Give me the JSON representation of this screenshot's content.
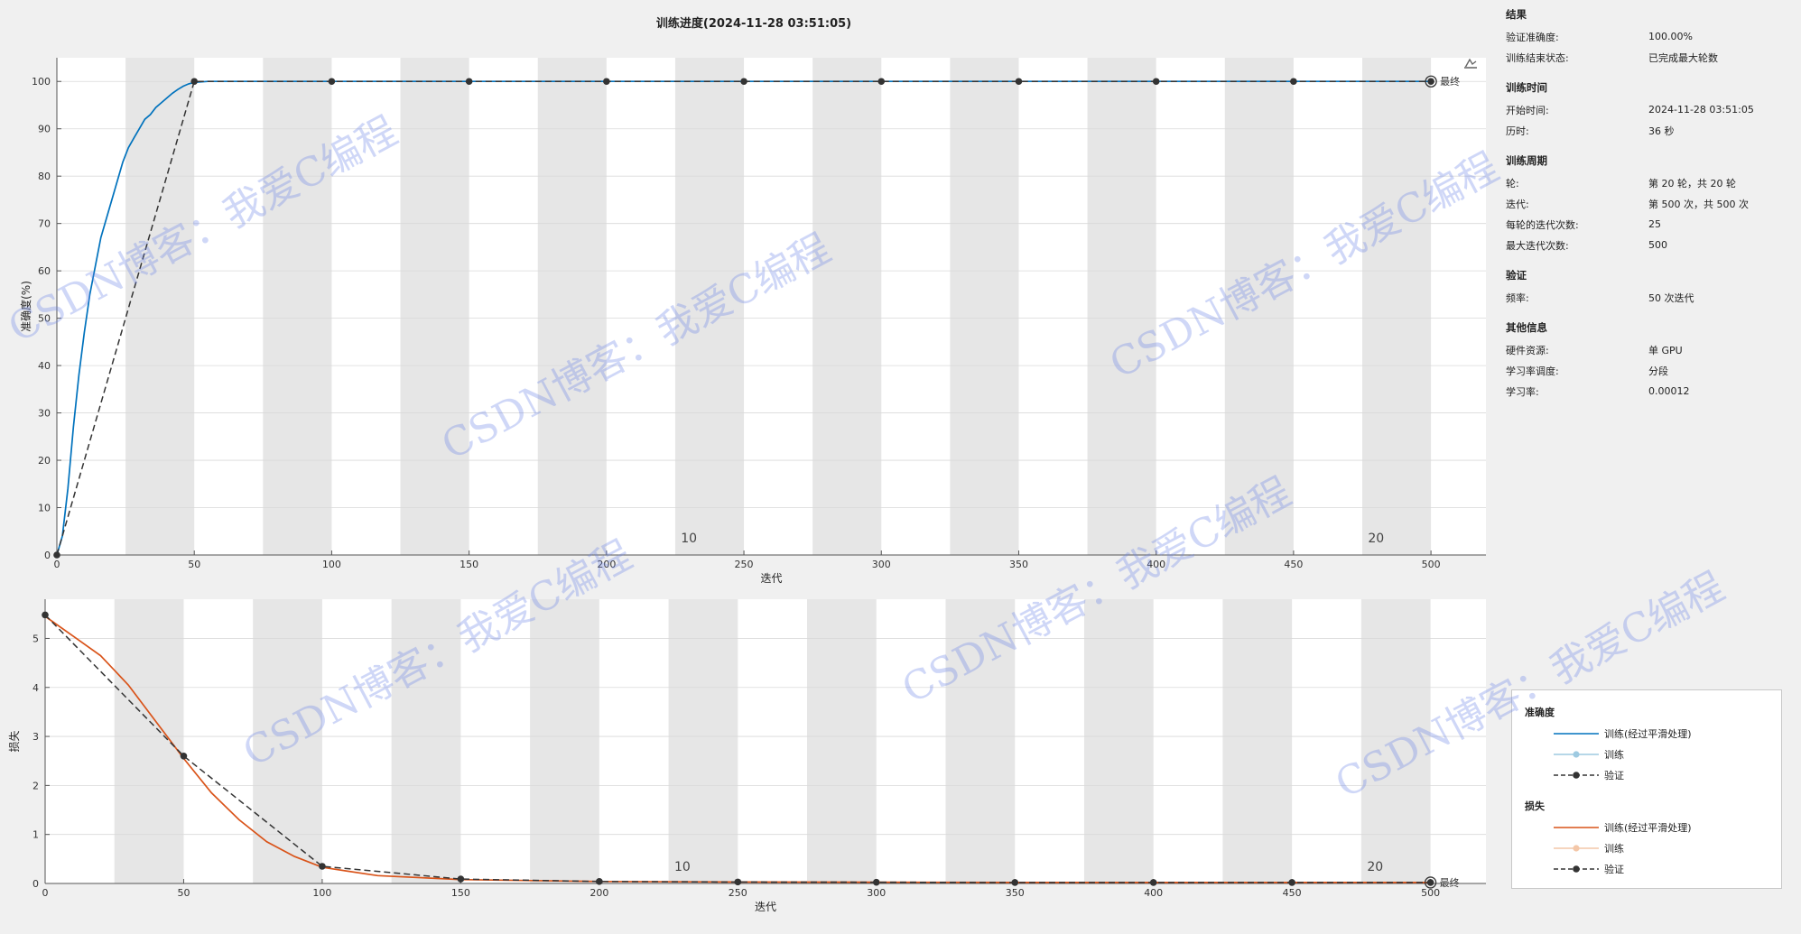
{
  "page": {
    "title": "训练进度(2024-11-28 03:51:05)"
  },
  "chart_data": [
    {
      "type": "line",
      "name": "accuracy-chart",
      "xlabel": "迭代",
      "ylabel": "准确度(%)",
      "xlim": [
        0,
        520
      ],
      "ylim": [
        0,
        105
      ],
      "xticks": [
        0,
        50,
        100,
        150,
        200,
        250,
        300,
        350,
        400,
        450,
        500
      ],
      "yticks": [
        0,
        10,
        20,
        30,
        40,
        50,
        60,
        70,
        80,
        90,
        100
      ],
      "epoch_band_iterations": 25,
      "epoch_labels": [
        {
          "iteration": 230,
          "text": "10"
        },
        {
          "iteration": 480,
          "text": "20"
        }
      ],
      "final_label": "最终",
      "series": [
        {
          "name": "训练(经过平滑处理)",
          "color": "#0072bd",
          "x": [
            0,
            2,
            4,
            6,
            8,
            10,
            12,
            14,
            16,
            18,
            20,
            22,
            24,
            26,
            28,
            30,
            32,
            34,
            36,
            38,
            40,
            42,
            44,
            46,
            48,
            50,
            55,
            60,
            80,
            100,
            150,
            200,
            250,
            300,
            350,
            400,
            450,
            500
          ],
          "y": [
            0,
            4,
            14,
            27,
            38,
            47,
            55,
            61,
            67,
            71,
            75,
            79,
            83,
            86,
            88,
            90,
            92,
            93,
            94.5,
            95.5,
            96.5,
            97.5,
            98.3,
            99,
            99.5,
            99.8,
            100,
            100,
            100,
            100,
            100,
            100,
            100,
            100,
            100,
            100,
            100,
            100
          ]
        },
        {
          "name": "验证",
          "color": "#333333",
          "x": [
            0,
            50,
            100,
            150,
            200,
            250,
            300,
            350,
            400,
            450,
            500
          ],
          "y": [
            0,
            100,
            100,
            100,
            100,
            100,
            100,
            100,
            100,
            100,
            100
          ]
        }
      ]
    },
    {
      "type": "line",
      "name": "loss-chart",
      "xlabel": "迭代",
      "ylabel": "损失",
      "xlim": [
        0,
        520
      ],
      "ylim": [
        0,
        5.8
      ],
      "xticks": [
        0,
        50,
        100,
        150,
        200,
        250,
        300,
        350,
        400,
        450,
        500
      ],
      "yticks": [
        0,
        1,
        2,
        3,
        4,
        5
      ],
      "epoch_band_iterations": 25,
      "epoch_labels": [
        {
          "iteration": 230,
          "text": "10"
        },
        {
          "iteration": 480,
          "text": "20"
        }
      ],
      "final_label": "最终",
      "series": [
        {
          "name": "训练(经过平滑处理)",
          "color": "#d95319",
          "x": [
            0,
            10,
            20,
            30,
            40,
            50,
            60,
            70,
            80,
            90,
            100,
            120,
            150,
            200,
            250,
            300,
            350,
            400,
            450,
            500
          ],
          "y": [
            5.45,
            5.05,
            4.65,
            4.05,
            3.3,
            2.55,
            1.85,
            1.3,
            0.85,
            0.55,
            0.33,
            0.16,
            0.08,
            0.04,
            0.03,
            0.025,
            0.02,
            0.02,
            0.02,
            0.02
          ]
        },
        {
          "name": "验证",
          "color": "#333333",
          "x": [
            0,
            50,
            100,
            150,
            200,
            250,
            300,
            350,
            400,
            450,
            500
          ],
          "y": [
            5.48,
            2.6,
            0.35,
            0.09,
            0.04,
            0.03,
            0.025,
            0.02,
            0.02,
            0.02,
            0.02
          ]
        }
      ]
    }
  ],
  "info": {
    "sections": [
      {
        "title": "结果",
        "rows": [
          [
            "验证准确度:",
            "100.00%"
          ],
          [
            "训练结束状态:",
            "已完成最大轮数"
          ]
        ]
      },
      {
        "title": "训练时间",
        "rows": [
          [
            "开始时间:",
            "2024-11-28 03:51:05"
          ],
          [
            "历时:",
            "36 秒"
          ]
        ]
      },
      {
        "title": "训练周期",
        "rows": [
          [
            "轮:",
            "第 20 轮，共 20 轮"
          ],
          [
            "迭代:",
            "第 500 次，共 500 次"
          ],
          [
            "每轮的迭代次数:",
            "25"
          ],
          [
            "最大迭代次数:",
            "500"
          ]
        ]
      },
      {
        "title": "验证",
        "rows": [
          [
            "频率:",
            "50 次迭代"
          ]
        ]
      },
      {
        "title": "其他信息",
        "rows": [
          [
            "硬件资源:",
            "单 GPU"
          ],
          [
            "学习率调度:",
            "分段"
          ],
          [
            "学习率:",
            "0.00012"
          ]
        ]
      }
    ]
  },
  "legend": {
    "accuracy_title": "准确度",
    "loss_title": "损失",
    "smoothed": "训练(经过平滑处理)",
    "train": "训练",
    "validation": "验证",
    "colors": {
      "acc_smoothed": "#0072bd",
      "acc_train": "#9ecae1",
      "loss_smoothed": "#d95319",
      "loss_train": "#f4c7a8",
      "validation": "#333333"
    }
  },
  "watermark": {
    "text": "CSDN博客：我爱C编程"
  }
}
